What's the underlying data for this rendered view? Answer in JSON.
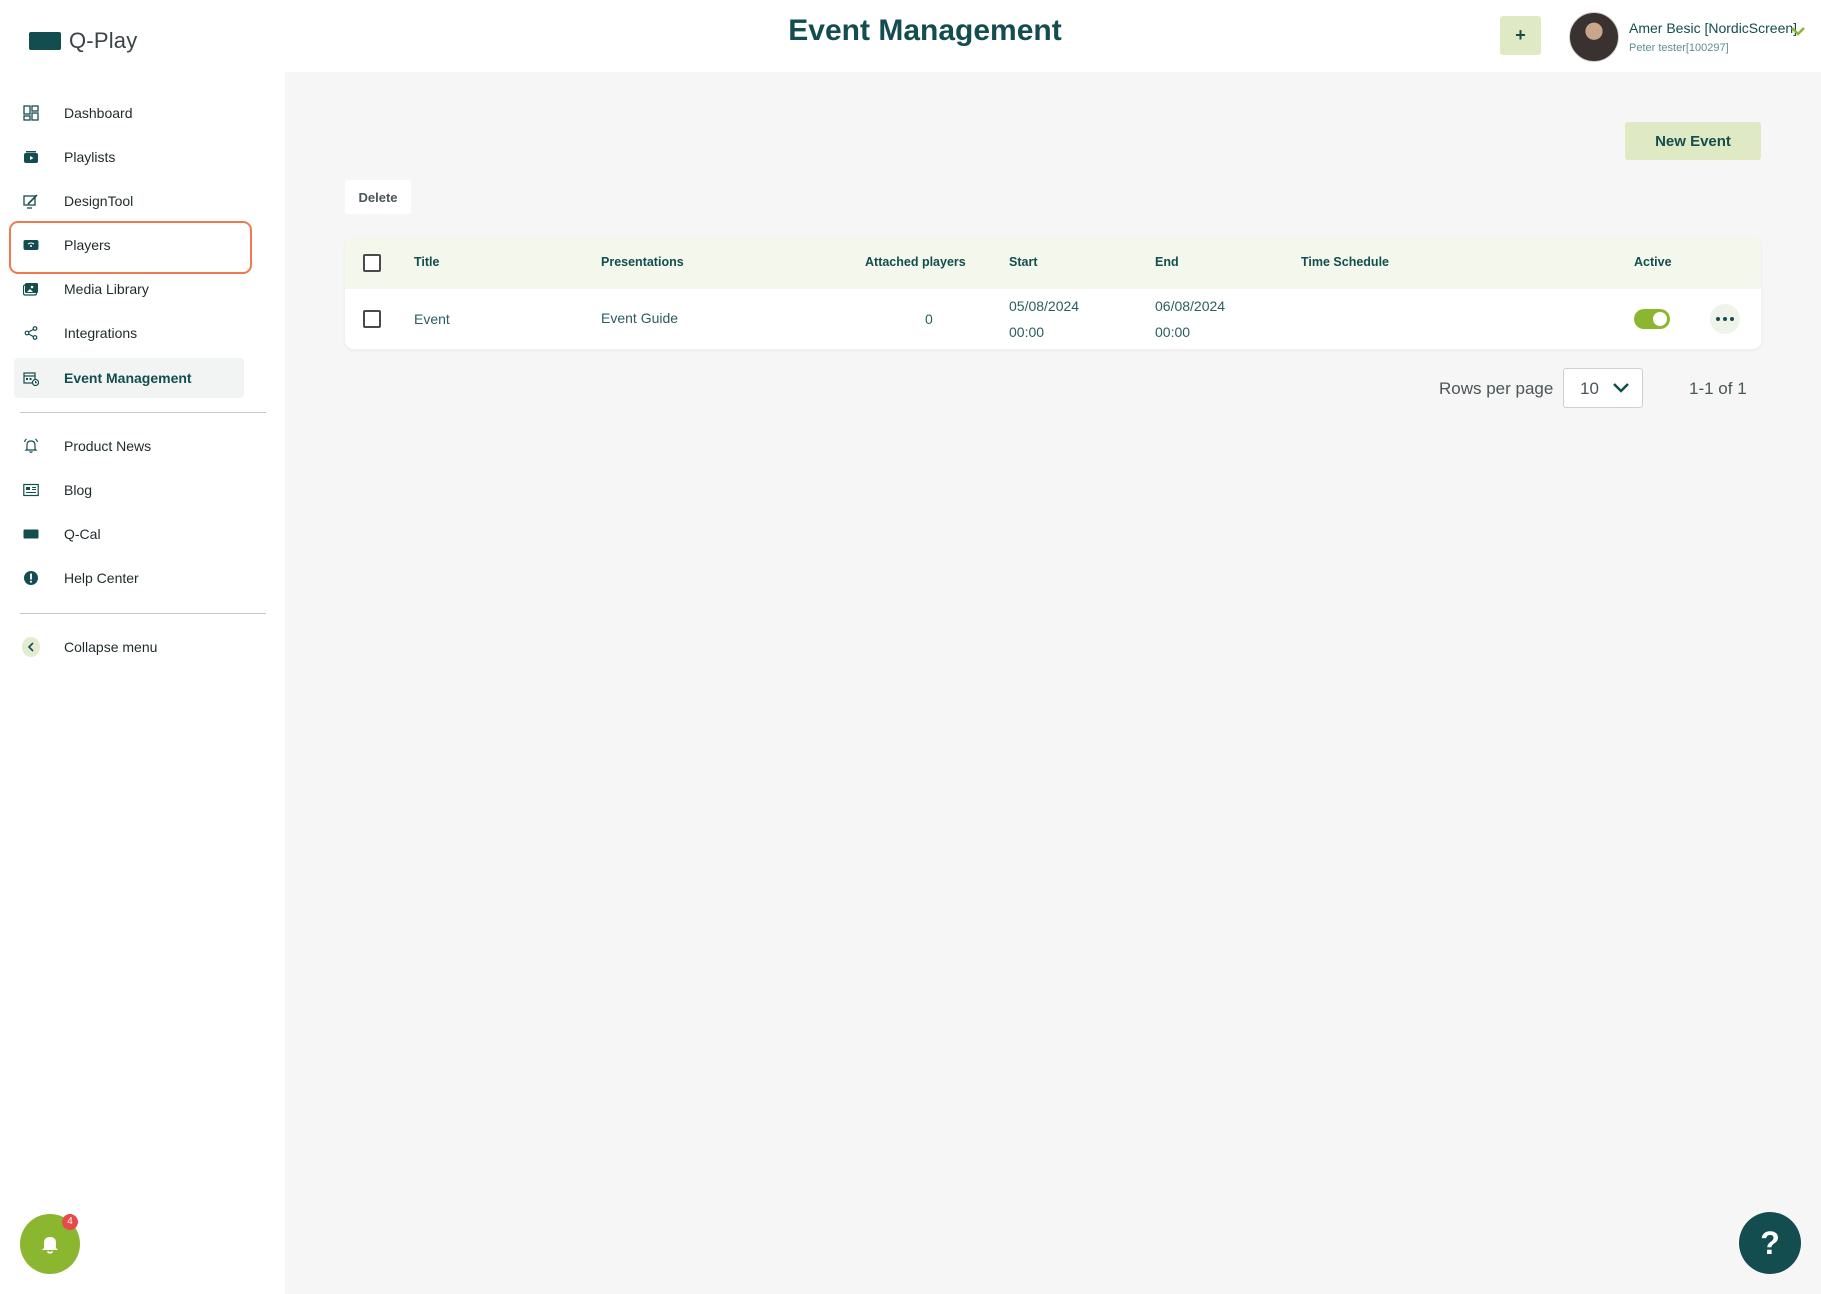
{
  "header": {
    "logo_text": "Q-Play",
    "title": "Event Management",
    "add_label": "+",
    "user_name": "Amer Besic [NordicScreen]",
    "user_sub": "Peter tester[100297]"
  },
  "sidebar": {
    "items": [
      {
        "label": "Dashboard",
        "icon": "dashboard-icon"
      },
      {
        "label": "Playlists",
        "icon": "playlist-icon"
      },
      {
        "label": "DesignTool",
        "icon": "design-icon"
      },
      {
        "label": "Players",
        "icon": "player-icon"
      },
      {
        "label": "Media Library",
        "icon": "media-icon"
      },
      {
        "label": "Integrations",
        "icon": "share-icon"
      },
      {
        "label": "Event Management",
        "icon": "calendar-icon"
      }
    ],
    "secondary": [
      {
        "label": "Product News",
        "icon": "bell-icon"
      },
      {
        "label": "Blog",
        "icon": "newspaper-icon"
      },
      {
        "label": "Q-Cal",
        "icon": "qcal-icon"
      },
      {
        "label": "Help Center",
        "icon": "info-icon"
      }
    ],
    "collapse_label": "Collapse menu",
    "notification_count": "4"
  },
  "toolbar": {
    "new_event_label": "New Event",
    "delete_label": "Delete"
  },
  "table": {
    "columns": [
      "Title",
      "Presentations",
      "Attached players",
      "Start",
      "End",
      "Time Schedule",
      "Active"
    ],
    "rows": [
      {
        "title": "Event",
        "presentations": "Event Guide",
        "attached_players": "0",
        "start_date": "05/08/2024",
        "start_time": "00:00",
        "end_date": "06/08/2024",
        "end_time": "00:00",
        "time_schedule": "",
        "active": true
      }
    ]
  },
  "pagination": {
    "rows_per_page_label": "Rows per page",
    "rows_per_page": "10",
    "range": "1-1 of 1"
  },
  "help_label": "?",
  "colors": {
    "brand": "#134d4f",
    "accent": "#8bb630",
    "accent_light": "#dfeac4",
    "highlight": "#f07a4f"
  }
}
